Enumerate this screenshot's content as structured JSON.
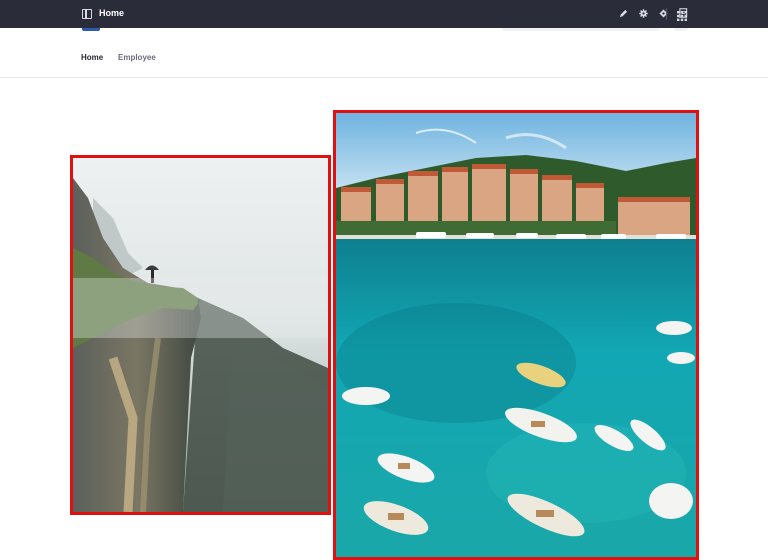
{
  "topbar": {
    "title": "Home",
    "icons": [
      "panel-toggle-icon",
      "pencil-icon",
      "gear-icon",
      "diamond-icon",
      "page-info-icon",
      "apps-grid-icon"
    ]
  },
  "nav": {
    "items": [
      {
        "label": "Home",
        "active": true
      },
      {
        "label": "Employee",
        "active": false
      }
    ]
  },
  "images": [
    {
      "subject": "misty cliff with person holding umbrella",
      "highlight": "#e01010"
    },
    {
      "subject": "coastal town harbor with turquoise water and boats",
      "highlight": "#e01010"
    }
  ],
  "colors": {
    "topbar_bg": "#2b2c3a",
    "highlight_border": "#e01010",
    "brand": "#2e5aac"
  }
}
